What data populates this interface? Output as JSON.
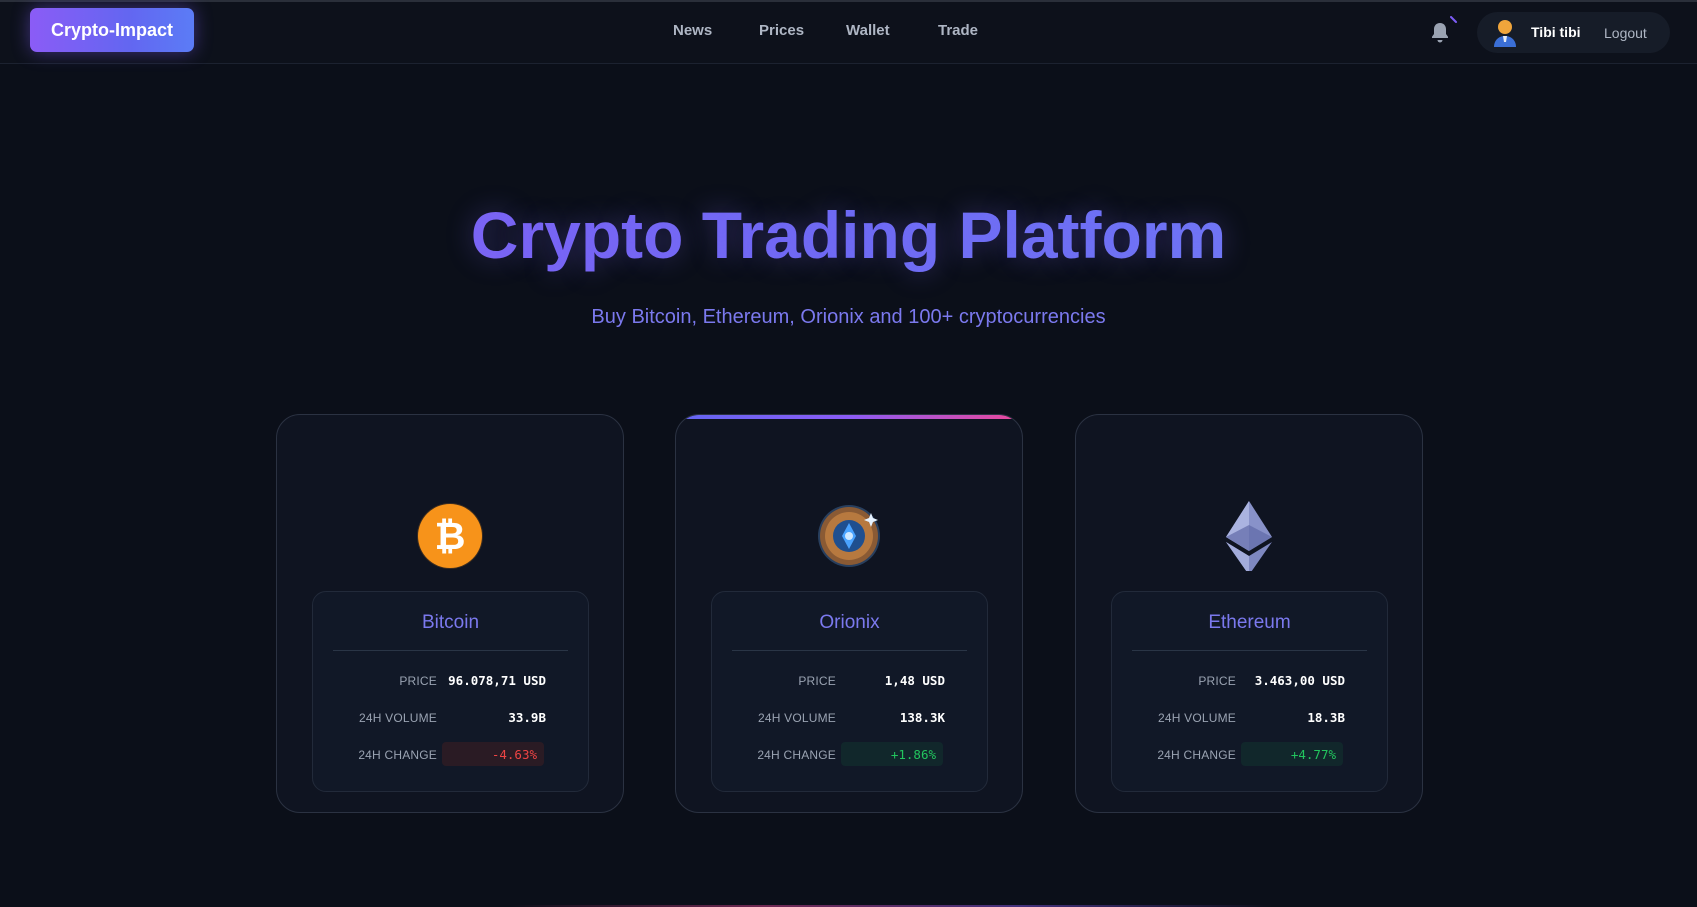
{
  "header": {
    "brand": "Crypto-Impact",
    "nav": [
      {
        "label": "News"
      },
      {
        "label": "Prices"
      },
      {
        "label": "Wallet"
      },
      {
        "label": "Trade"
      }
    ],
    "bell_icon": "bell-icon",
    "user": {
      "name": "Tibi tibi",
      "logout_label": "Logout",
      "avatar_icon": "user-avatar-icon"
    }
  },
  "hero": {
    "title": "Crypto Trading Platform",
    "subtitle": "Buy Bitcoin, Ethereum, Orionix and 100+ cryptocurrencies"
  },
  "labels": {
    "price": "PRICE",
    "volume": "24H VOLUME",
    "change": "24H CHANGE"
  },
  "coins": [
    {
      "name": "Bitcoin",
      "icon": "bitcoin-icon",
      "price": "96.078,71 USD",
      "volume": "33.9B",
      "change": "-4.63%",
      "change_direction": "negative"
    },
    {
      "name": "Orionix",
      "icon": "orionix-icon",
      "price": "1,48 USD",
      "volume": "138.3K",
      "change": "+1.86%",
      "change_direction": "positive",
      "featured": true
    },
    {
      "name": "Ethereum",
      "icon": "ethereum-icon",
      "price": "3.463,00 USD",
      "volume": "18.3B",
      "change": "+4.77%",
      "change_direction": "positive"
    }
  ],
  "colors": {
    "background": "#0b0f19",
    "accent": "#7b79ee",
    "brand_gradient_start": "#8b5cf6",
    "brand_gradient_end": "#5b7cf6",
    "negative": "#ef4444",
    "positive": "#22c55e",
    "bitcoin_orange": "#f7931a"
  }
}
